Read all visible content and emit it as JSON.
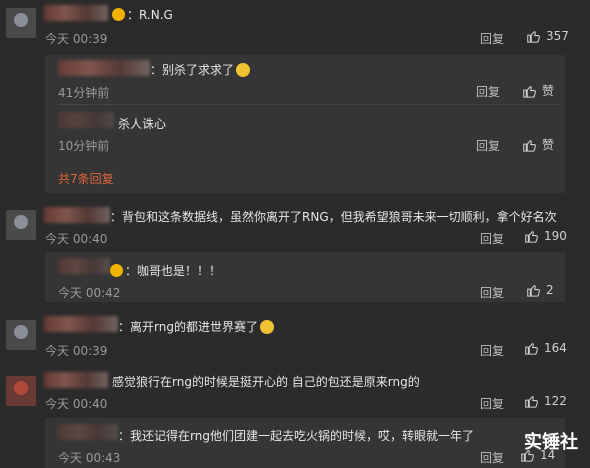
{
  "comments": [
    {
      "text": "：R.N.G",
      "time": "今天 00:39",
      "reply": "回复",
      "likes": "357"
    },
    {
      "text": "：背包和这条数据线，虽然你离开了RNG，但我希望狼哥未来一切顺利，拿个好名次",
      "time": "今天 00:40",
      "reply": "回复",
      "likes": "190"
    },
    {
      "text": "：离开rng的都进世界赛了",
      "time": "今天 00:39",
      "reply": "回复",
      "likes": "164"
    },
    {
      "text": "感觉狼行在rng的时候是挺开心的 自己的包还是原来rng的",
      "time": "今天 00:40",
      "reply": "回复",
      "likes": "122"
    }
  ],
  "replies": [
    {
      "text": "：别杀了求求了",
      "time": "41分钟前",
      "reply": "回复",
      "likes": "赞"
    },
    {
      "text": "杀人诛心",
      "time": "10分钟前",
      "reply": "回复",
      "likes": "赞"
    },
    {
      "text": "：咖哥也是！！！",
      "time": "今天 00:42",
      "reply": "回复",
      "likes": "2"
    },
    {
      "text": "：我还记得在rng他们团建一起去吃火锅的时候，哎，转眼就一年了",
      "time": "今天 00:43",
      "reply": "回复",
      "likes": "14"
    }
  ],
  "expand_label": "共7条回复",
  "watermark": "实锤社",
  "colors": {
    "background": "#2b2b2b",
    "nested": "#353535",
    "accent": "#e0653a"
  }
}
